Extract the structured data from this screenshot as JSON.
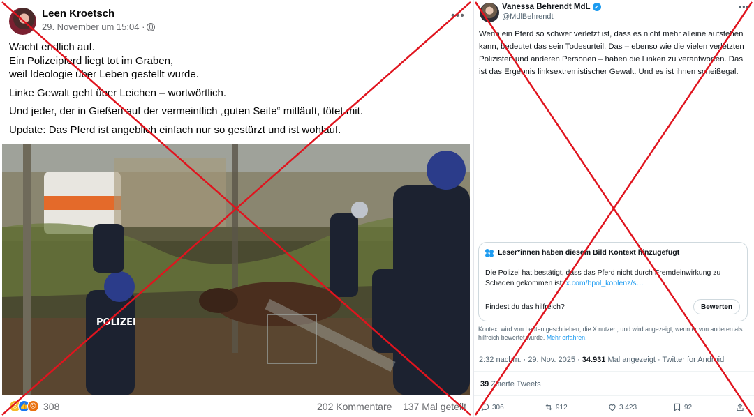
{
  "facebook": {
    "author": "Leen Kroetsch",
    "timestamp": "29. November um 15:04 ·",
    "privacy_icon": "globe-icon",
    "more_label": "•••",
    "paragraphs": [
      {
        "lines": [
          "Wacht endlich auf.",
          "Ein Polizeipferd liegt tot im Graben,",
          "weil Ideologie über Leben gestellt wurde."
        ]
      },
      {
        "lines": [
          "Linke Gewalt geht über Leichen – wortwörtlich."
        ]
      },
      {
        "lines": [
          "Und jeder, der in Gießen auf der vermeintlich „guten Seite“ mitläuft, tötet mit."
        ]
      },
      {
        "lines": [
          "Update: Das Pferd ist angeblich einfach nur so  gestürzt und ist wohlauf."
        ]
      }
    ],
    "reactions": {
      "icons": [
        "sad-reaction-icon",
        "like-reaction-icon",
        "angry-reaction-icon"
      ],
      "count": "308"
    },
    "comments": "202 Kommentare",
    "shares": "137 Mal geteilt"
  },
  "twitter": {
    "name": "Vanessa Behrendt MdL",
    "verified_icon": "verified-badge-icon",
    "handle": "@MdlBehrendt",
    "more_label": "•••",
    "text": "Wenn ein Pferd so schwer verletzt ist, dass es nicht mehr alleine aufstehen kann, bedeutet das sein Todesurteil. Das – ebenso wie die vielen verletzten Polizisten und anderen Personen – haben die Linken zu verantworten. Das ist das Ergebnis linksextremistischer Gewalt. Und es ist ihnen scheißegal.",
    "community_note": {
      "title": "Leser*innen haben diesem Bild Kontext hinzugefügt",
      "body_text": "Die Polizei hat bestätigt, dass das Pferd nicht durch Fremdeinwirkung zu Schaden gekommen ist: ",
      "body_link": "x.com/bpol_koblenz/s…",
      "question": "Findest du das hilfreich?",
      "rate_button": "Bewerten"
    },
    "note_footer_text": "Kontext wird von Leuten geschrieben, die X nutzen, und wird angezeigt, wenn er von anderen als hilfreich bewertet wurde.",
    "note_footer_link": "Mehr erfahren.",
    "time": "2:32 nachm. · 29. Nov. 2025 · ",
    "views_count": "34.931",
    "views_label": " Mal angezeigt · Twitter for Android",
    "quotes_count": "39",
    "quotes_label": " Zitierte Tweets",
    "actions": {
      "replies": "306",
      "reposts": "912",
      "likes": "3.423",
      "bookmarks": "92"
    }
  },
  "colors": {
    "cross": "#e0141e",
    "facebook_meta": "#65676b",
    "twitter_link": "#1d9bf0",
    "twitter_meta": "#536471"
  }
}
